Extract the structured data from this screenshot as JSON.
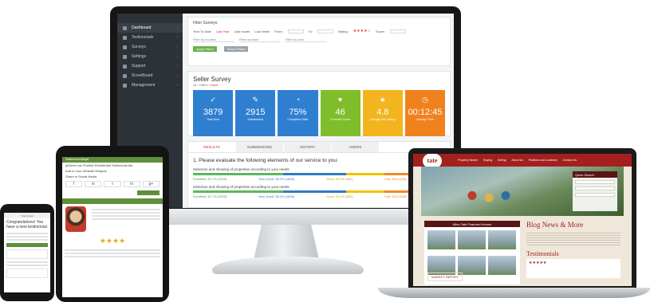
{
  "desktop": {
    "sidebar": [
      {
        "label": "Dashboard",
        "active": true
      },
      {
        "label": "Testimonials",
        "active": false
      },
      {
        "label": "Surveys",
        "active": false
      },
      {
        "label": "Settings",
        "active": false
      },
      {
        "label": "Support",
        "active": false
      },
      {
        "label": "ScoreBoard",
        "active": false
      },
      {
        "label": "Management",
        "active": false
      }
    ],
    "filters": {
      "title": "Filter Surveys",
      "ranges": [
        "Year To Date",
        "Last Year",
        "Last month",
        "Last Week"
      ],
      "from_label": "From:",
      "to_label": "To:",
      "rating_label": "Rating:",
      "rating_stars": "★★★★☆",
      "score_label": "Score:",
      "location_placeholder": "Filter by location",
      "team_placeholder": "Filter by team",
      "user_placeholder": "Filter by user",
      "apply_label": "Apply Filters",
      "reset_label": "Reset Filters"
    },
    "seller_survey": {
      "title": "Seller Survey",
      "subtitle_prefix": "All / Offers /",
      "subtitle_link": "Done",
      "tiles": [
        {
          "icon": "✓",
          "value": "3879",
          "label": "Total Sent",
          "color": "#2f7fd0"
        },
        {
          "icon": "✎",
          "value": "2915",
          "label": "Submissions",
          "color": "#2f7fd0"
        },
        {
          "icon": "◔",
          "value": "75%",
          "label": "Completion Rate",
          "color": "#2f7fd0"
        },
        {
          "icon": "♥",
          "value": "46",
          "label": "Promoter Score",
          "color": "#7fbe2a"
        },
        {
          "icon": "★",
          "value": "4.8",
          "label": "Average User Rating",
          "color": "#f2b51f"
        },
        {
          "icon": "◷",
          "value": "00:12:45",
          "label": "Average Time",
          "color": "#f0821e"
        }
      ]
    },
    "results": {
      "tabs": [
        "RESULTS",
        "SUBMISSIONS",
        "HISTORY",
        "USERS"
      ],
      "question": "1. Please evaluate the following elements of our service to you:",
      "items": [
        {
          "label": "Selection and showing of properties according to your needs",
          "segments": [
            {
              "name": "Excellent",
              "text": "Excellent: 51.7% (2913)",
              "pct": 51.7,
              "color": "#5cb85c",
              "cls": "g"
            },
            {
              "name": "Very Good",
              "text": "Very Good: 36.2% (1809)",
              "pct": 36.2,
              "color": "#2f7bc3",
              "cls": "b"
            },
            {
              "name": "Good",
              "text": "Good: 22.0% (682)",
              "pct": 22.0,
              "color": "#f2c200",
              "cls": "y"
            },
            {
              "name": "Fair",
              "text": "Fair: 31% (318)",
              "pct": 31,
              "color": "#f08a24",
              "cls": "o"
            },
            {
              "name": "Poor",
              "text": "Poor",
              "pct": 4,
              "color": "#d9262c",
              "cls": "r"
            }
          ]
        },
        {
          "label": "Selection and showing of properties according to your needs",
          "segments": [
            {
              "name": "Excellent",
              "text": "Excellent: 51.7% (2913)",
              "pct": 51.7,
              "color": "#5cb85c",
              "cls": "g"
            },
            {
              "name": "Very Good",
              "text": "Very Good: 36.2% (1809)",
              "pct": 36.2,
              "color": "#2f7bc3",
              "cls": "b"
            },
            {
              "name": "Good",
              "text": "Good: 22.0% (682)",
              "pct": 22.0,
              "color": "#f2c200",
              "cls": "y"
            },
            {
              "name": "Fair",
              "text": "Fair: 31% (318)",
              "pct": 31,
              "color": "#f08a24",
              "cls": "o"
            },
            {
              "name": "Poor",
              "text": "Poor",
              "pct": 4,
              "color": "#d9262c",
              "cls": "r"
            }
          ]
        }
      ]
    }
  },
  "laptop": {
    "logo_text": "tate",
    "nav_links": [
      "Property Search",
      "Buying",
      "Selling",
      "About Us",
      "Realtors and Locations",
      "Contact Us"
    ],
    "quick_search_title": "Quick Search",
    "featured_title": "Allen Tate Featured Homes",
    "market_report": "MARKET REPORT",
    "blog_title": "Blog News & More",
    "testimonials_title": "Testimonials",
    "testimonial_stars": "★★★★★"
  },
  "tablet": {
    "header": "Testimonial Widget",
    "line1": "gWhere can Publish Residential Testimonial tab",
    "line2": "Add to Your Website Widgets",
    "share_label": "Share to Social Media",
    "social": [
      "f",
      "in",
      "t",
      "in",
      "g+"
    ],
    "stars": "★★★★"
  },
  "phone": {
    "header": "Testimonial",
    "title": "Congratulations! You have a new testimonial"
  }
}
